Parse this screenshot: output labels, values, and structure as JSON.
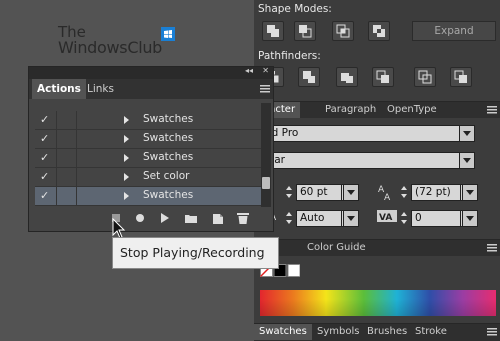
{
  "watermark": {
    "line1": "The",
    "line2": "WindowsClub"
  },
  "right_panel": {
    "shape_modes_label": "Shape Modes:",
    "expand_label": "Expand",
    "pathfinders_label": "Pathfinders:",
    "character_tabs": [
      "aracter",
      "Paragraph",
      "OpenType"
    ],
    "font_family": "riad Pro",
    "font_style": "gular",
    "font_size": "60 pt",
    "leading": "(72 pt)",
    "kerning": "Auto",
    "tracking": "0",
    "color_tabs": [
      "lor",
      "Color Guide"
    ],
    "bottom_tabs": [
      "Swatches",
      "Symbols",
      "Brushes",
      "Stroke"
    ]
  },
  "actions_panel": {
    "tabs": [
      "Actions",
      "Links"
    ],
    "rows": [
      {
        "check": "✓",
        "label": "Swatches",
        "selected": false
      },
      {
        "check": "✓",
        "label": "Swatches",
        "selected": false
      },
      {
        "check": "✓",
        "label": "Swatches",
        "selected": false
      },
      {
        "check": "✓",
        "label": "Set color",
        "selected": false
      },
      {
        "check": "✓",
        "label": "Swatches",
        "selected": true
      }
    ],
    "collapse_glyph": "◂◂",
    "close_glyph": "✕"
  },
  "tooltip": {
    "text": "Stop Playing/Recording"
  },
  "colors": {
    "panel_bg": "#3c3c3c",
    "selected_row": "#5d6672",
    "tooltip_bg": "#efefef"
  }
}
